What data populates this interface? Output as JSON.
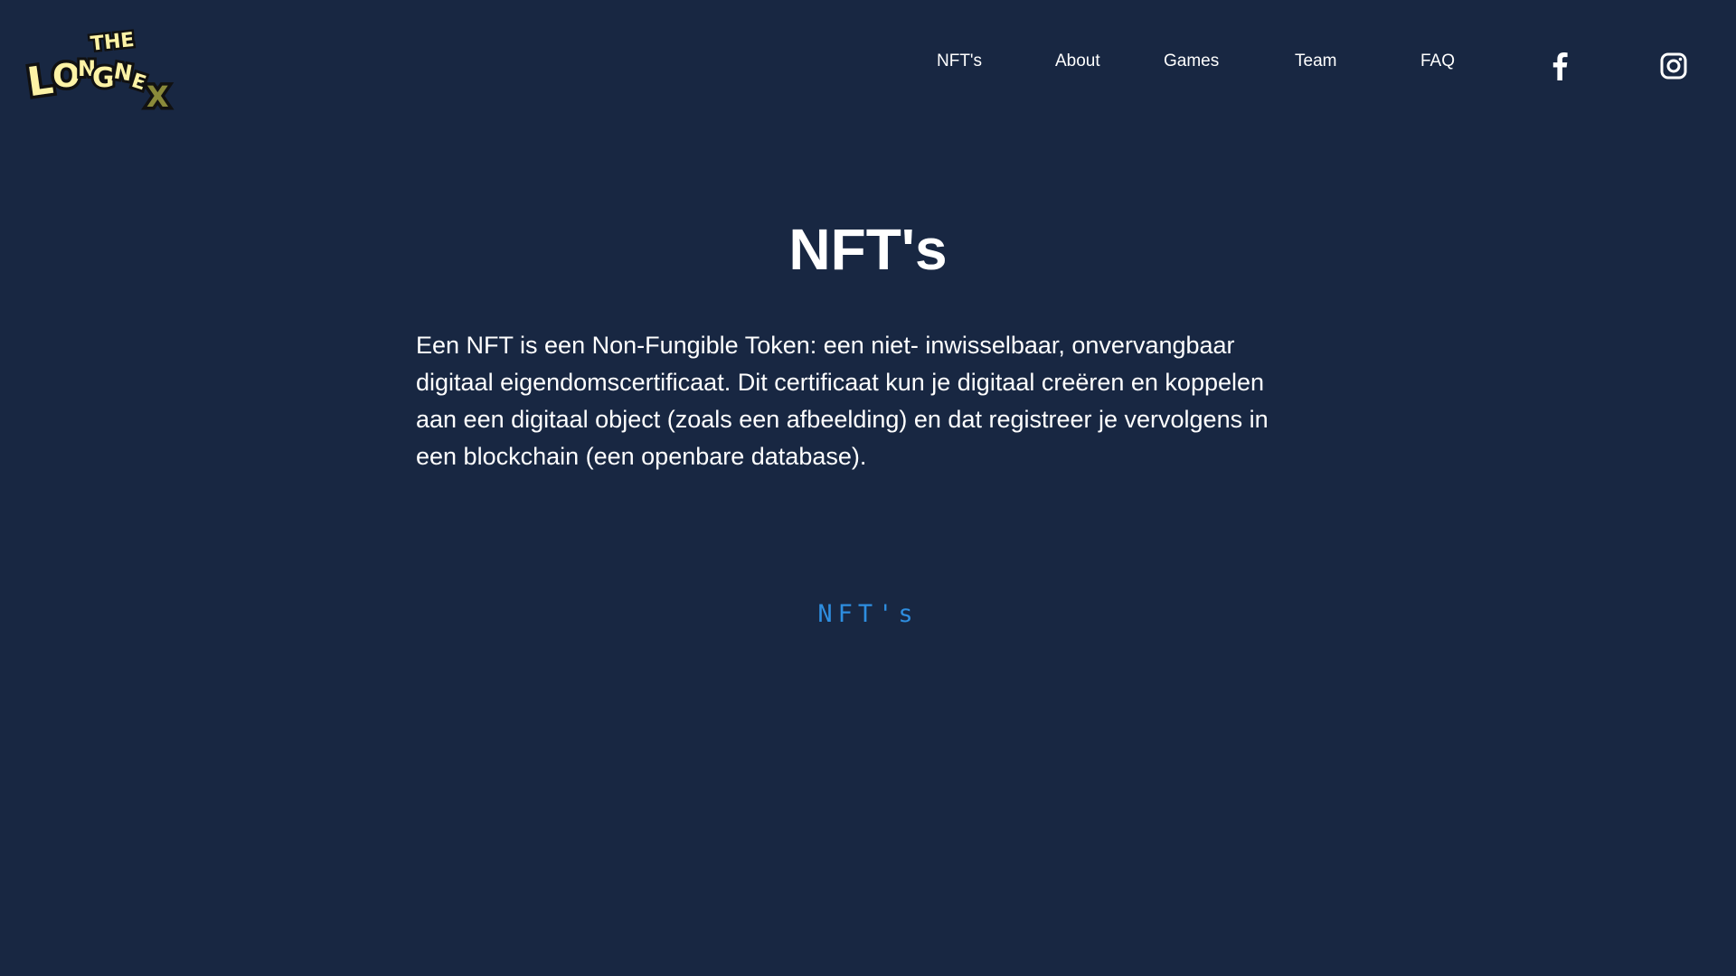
{
  "logo": {
    "line1": "THE",
    "line2": "LONGNEX",
    "colors": {
      "fill": "#fdf3a6",
      "outline": "#111111",
      "x_fill": "#8a8a3a"
    }
  },
  "nav": {
    "items": [
      {
        "label": "NFT's"
      },
      {
        "label": "About"
      },
      {
        "label": "Games"
      },
      {
        "label": "Team"
      },
      {
        "label": "FAQ"
      }
    ],
    "social": [
      {
        "icon": "facebook-icon"
      },
      {
        "icon": "instagram-icon"
      }
    ]
  },
  "main": {
    "title": "NFT's",
    "intro": "Een NFT is een Non-Fungible Token: een niet- inwisselbaar, onvervangbaar digitaal eigendomscertificaat. Dit certificaat kun je digitaal creëren en koppelen aan een digitaal object (zoals een afbeelding) en dat registreer je vervolgens in een blockchain (een openbare database).",
    "section_label": "NFT's"
  },
  "colors": {
    "background": "#182742",
    "text": "#ffffff",
    "accent": "#2e8ee0"
  }
}
